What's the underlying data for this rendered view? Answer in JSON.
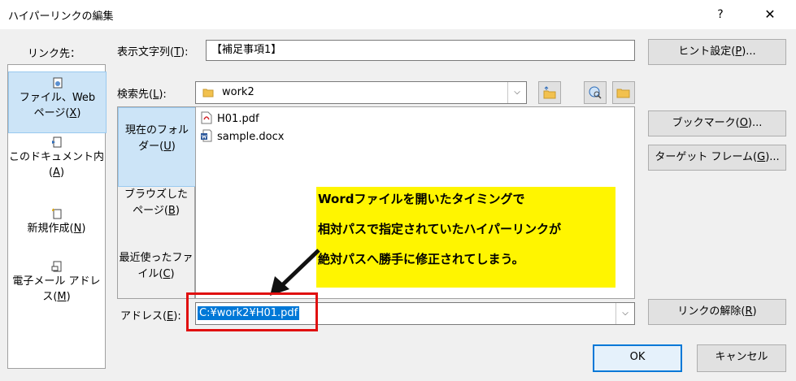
{
  "window": {
    "title": "ハイパーリンクの編集",
    "help": "?",
    "close": "✕"
  },
  "sidebar": {
    "label": "リンク先：",
    "items": [
      {
        "line1": "ファイル、Web",
        "line2a": "ページ(",
        "key": "X",
        "line2b": ")"
      },
      {
        "line1": "このドキュメント内",
        "line2a": "(",
        "key": "A",
        "line2b": ")"
      },
      {
        "line1a": "新規作成(",
        "key": "N",
        "line1b": ")"
      },
      {
        "line1": "電子メール アドレ",
        "line2a": "ス(",
        "key": "M",
        "line2b": ")"
      }
    ]
  },
  "display_text": {
    "label_a": "表示文字列(",
    "key": "T",
    "label_b": "):",
    "value": "【補足事項1】"
  },
  "lookin": {
    "label_a": "検索先(",
    "key": "L",
    "label_b": "):",
    "value": "work2"
  },
  "tabs": [
    {
      "line1": "現在のフォル",
      "line2a": "ダー(",
      "key": "U",
      "line2b": ")"
    },
    {
      "line1": "ブラウズした",
      "line2a": "ページ(",
      "key": "B",
      "line2b": ")"
    },
    {
      "line1": "最近使ったファ",
      "line2a": "イル(",
      "key": "C",
      "line2b": ")"
    }
  ],
  "files": [
    {
      "name": "H01.pdf",
      "icon": "pdf-icon"
    },
    {
      "name": "sample.docx",
      "icon": "word-icon"
    }
  ],
  "address": {
    "label_a": "アドレス(",
    "key": "E",
    "label_b": "):",
    "value": "C:¥work2¥H01.pdf"
  },
  "buttons": {
    "hint": {
      "a": "ヒント設定(",
      "key": "P",
      "b": ")..."
    },
    "bookmark": {
      "a": "ブックマーク(",
      "key": "O",
      "b": ")..."
    },
    "target": {
      "a": "ターゲット フレーム(",
      "key": "G",
      "b": ")..."
    },
    "remove": {
      "a": "リンクの解除(",
      "key": "R",
      "b": ")"
    },
    "ok": "OK",
    "cancel": "キャンセル"
  },
  "annotation": {
    "lines": [
      "Wordファイルを開いたタイミングで",
      "相対パスで指定されていたハイパーリンクが",
      "絶対パスへ勝手に修正されてしまう。"
    ]
  },
  "colors": {
    "accent": "#0078d7",
    "selected": "#cce4f7",
    "note_bg": "#fff500",
    "highlight": "#e01010"
  }
}
